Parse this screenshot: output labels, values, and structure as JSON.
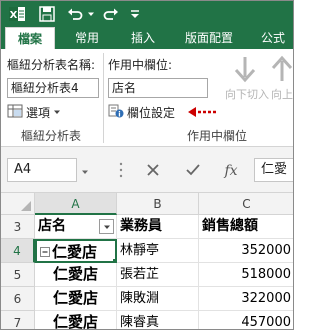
{
  "qat": {
    "icons": [
      "excel-app-icon",
      "save-icon",
      "undo-icon",
      "redo-icon",
      "customize-qat-icon"
    ]
  },
  "tabs": [
    {
      "label": "檔案",
      "active": true
    },
    {
      "label": "常用"
    },
    {
      "label": "插入"
    },
    {
      "label": "版面配置"
    },
    {
      "label": "公式"
    }
  ],
  "ribbon": {
    "pivot_name_label": "樞紐分析表名稱:",
    "pivot_name_value": "樞紐分析表4",
    "options_label": "選項",
    "group_pivot_label": "樞紐分析表",
    "active_field_label": "作用中欄位:",
    "active_field_value": "店名",
    "field_settings_label": "欄位設定",
    "drill_down_label": "向下切入",
    "drill_up_label": "向上",
    "group_active_field_label": "作用中欄位",
    "accent_arrow_color": "#cc0000"
  },
  "formula_bar": {
    "name_box": "A4",
    "formula_text": "仁愛"
  },
  "grid": {
    "columns": [
      "A",
      "B",
      "C"
    ],
    "selected_column": "A",
    "selected_row": "4",
    "rows": [
      {
        "num": "3",
        "cells": [
          "店名",
          "業務員",
          "銷售總額"
        ],
        "header": true
      },
      {
        "num": "4",
        "cells": [
          "仁愛店",
          "林靜亭",
          "352000"
        ],
        "expand": true
      },
      {
        "num": "5",
        "cells": [
          "仁愛店",
          "張若芷",
          "518000"
        ]
      },
      {
        "num": "6",
        "cells": [
          "仁愛店",
          "陳敗淵",
          "322000"
        ]
      },
      {
        "num": "7",
        "cells": [
          "仁愛店",
          "陳睿真",
          "457000"
        ]
      }
    ]
  }
}
